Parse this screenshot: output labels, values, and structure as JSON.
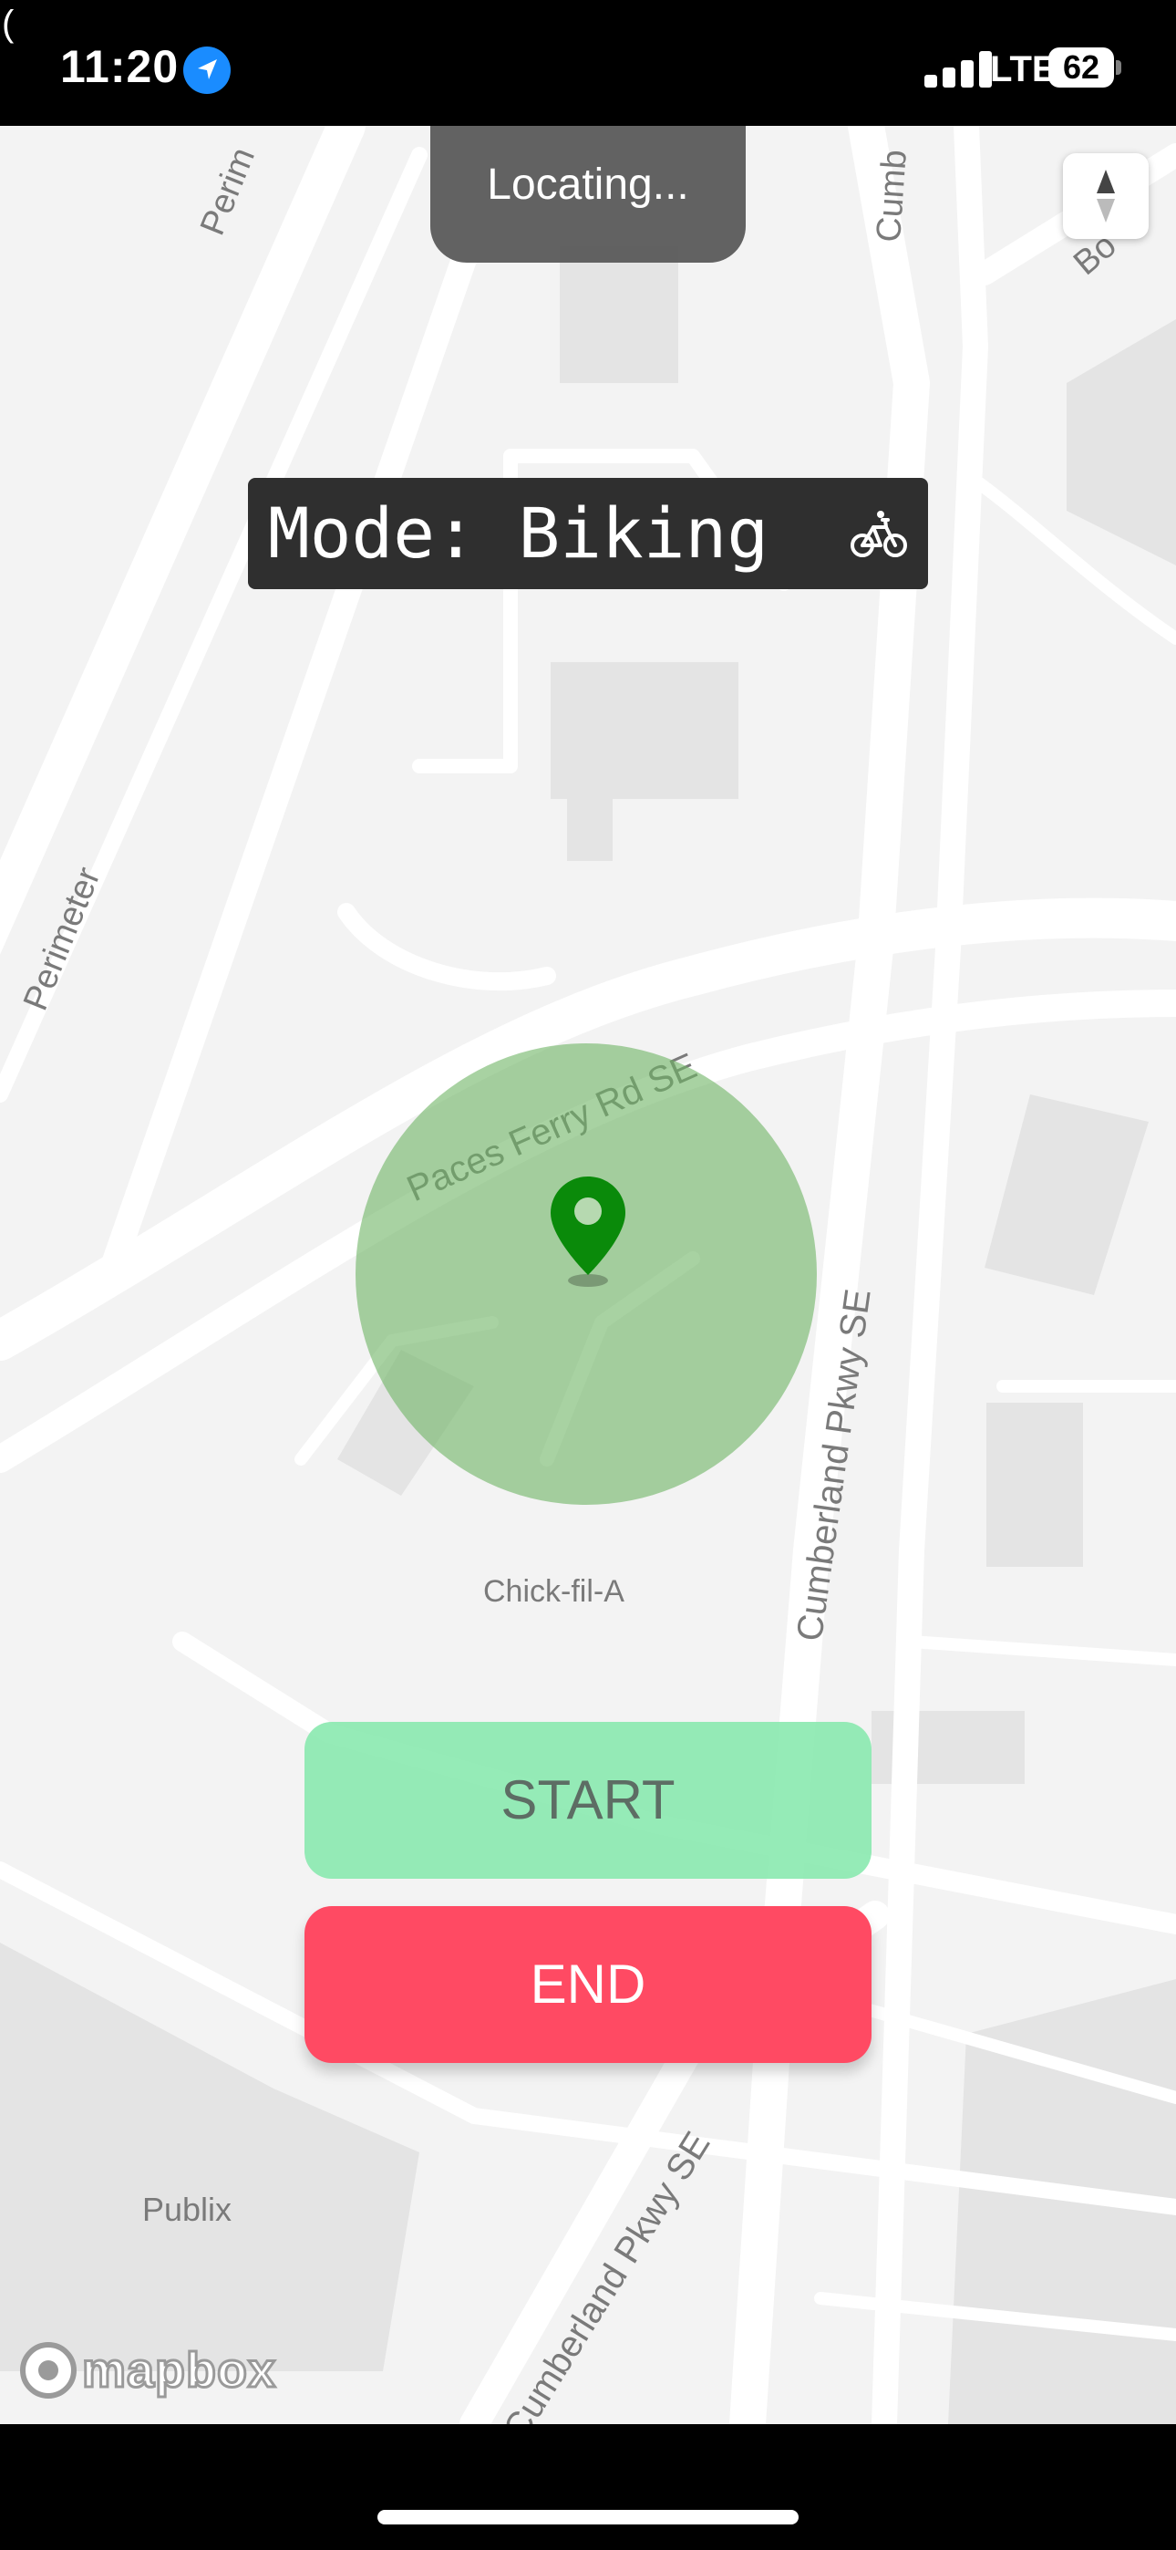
{
  "status_bar": {
    "paren": "(",
    "time": "11:20",
    "network": "LTE",
    "battery": "62"
  },
  "map": {
    "labels": {
      "perimeter_top": "Perim",
      "perimeter_left": "Perimeter",
      "cumb_top": "Cumb",
      "boundary": "Bo",
      "paces_ferry": "Paces Ferry Rd SE",
      "cumberland_right": "Cumberland Pkwy SE",
      "chick_fil_a": "Chick-fil-A",
      "publix": "Publix",
      "cumberland_bottom": "Cumberland Pkwy SE"
    },
    "attribution": "mapbox"
  },
  "toast": {
    "text": "Locating..."
  },
  "mode": {
    "label": "Mode: Biking",
    "icon": "bicycle-icon"
  },
  "buttons": {
    "start": "START",
    "end": "END"
  },
  "colors": {
    "accent_green": "#82E8AA",
    "end_red": "#FF4A63",
    "pin_green": "#0A8A0A",
    "accuracy_fill": "#6EB464"
  }
}
